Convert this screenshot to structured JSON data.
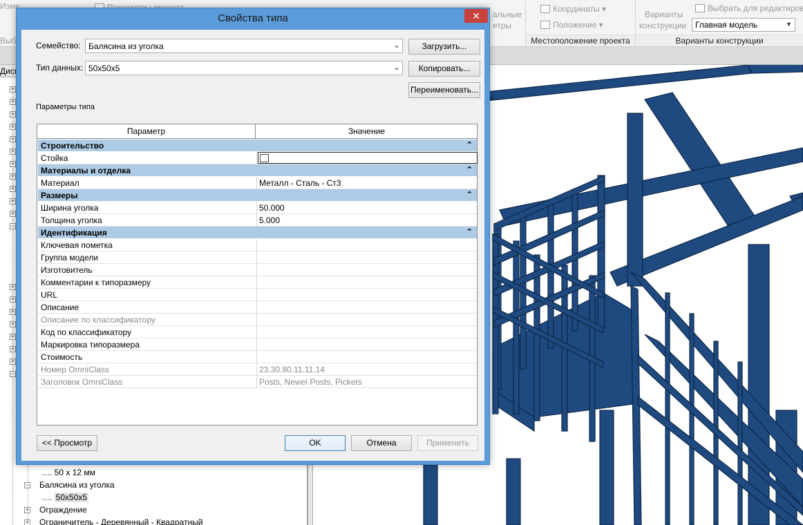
{
  "ribbon": {
    "left_partial": "Изме",
    "params_partial": "Параметры проекта",
    "left2_partial": "Выб",
    "walls_partial": "альные",
    "walls2_partial": "етры",
    "coordinates": "Координаты",
    "position": "Положение",
    "location_panel": "Местоположение проекта",
    "variants_btn_line1": "Варианты",
    "variants_btn_line2": "конструкции",
    "pick_for_edit": "Выбрать для редактирова",
    "main_model": "Главная модель",
    "variants_panel": "Варианты конструкции"
  },
  "browser": {
    "header": "Диспе",
    "items": [
      {
        "label": "50 x 12 мм",
        "indent": 2
      },
      {
        "label": "Балясина из уголка",
        "indent": 1
      },
      {
        "label": "50x50x5",
        "indent": 2
      },
      {
        "label": "Ограждение",
        "indent": 1
      },
      {
        "label": "Ограничитель - Деревянный - Квадратный",
        "indent": 1
      }
    ]
  },
  "dialog": {
    "title": "Свойства типа",
    "family_label": "Семейство:",
    "family_value": "Балясина из уголка",
    "type_label": "Тип данных:",
    "type_value": "50x50x5",
    "load_btn": "Загрузить...",
    "copy_btn": "Копировать...",
    "rename_btn": "Переименовать...",
    "params_label": "Параметры типа",
    "col_param": "Параметр",
    "col_value": "Значение",
    "preview_btn": "<< Просмотр",
    "ok_btn": "OK",
    "cancel_btn": "Отмена",
    "apply_btn": "Применить"
  },
  "groups": [
    {
      "name": "Строительство",
      "rows": [
        {
          "k": "Стойка",
          "v": "",
          "checkbox": true
        }
      ]
    },
    {
      "name": "Материалы и отделка",
      "rows": [
        {
          "k": "Материал",
          "v": "Металл - Сталь - Ст3"
        }
      ]
    },
    {
      "name": "Размеры",
      "rows": [
        {
          "k": "Ширина уголка",
          "v": "50.000"
        },
        {
          "k": "Толщина уголка",
          "v": "5.000"
        }
      ]
    },
    {
      "name": "Идентификация",
      "rows": [
        {
          "k": "Ключевая пометка",
          "v": ""
        },
        {
          "k": "Группа модели",
          "v": ""
        },
        {
          "k": "Изготовитель",
          "v": ""
        },
        {
          "k": "Комментарии к типоразмеру",
          "v": ""
        },
        {
          "k": "URL",
          "v": ""
        },
        {
          "k": "Описание",
          "v": ""
        },
        {
          "k": "Описание по классификатору",
          "v": "",
          "readonly": true
        },
        {
          "k": "Код по классификатору",
          "v": ""
        },
        {
          "k": "Маркировка типоразмера",
          "v": ""
        },
        {
          "k": "Стоимость",
          "v": ""
        },
        {
          "k": "Номер OmniClass",
          "v": "23.30.80.11.11.14",
          "readonly": true
        },
        {
          "k": "Заголовок OmniClass",
          "v": "Posts, Newel Posts, Pickets",
          "readonly": true
        }
      ]
    }
  ],
  "colors": {
    "steel": "#1e4a80",
    "dialog_frame": "#5b9bd9",
    "group_header": "#aecbe6",
    "close": "#c7423a"
  }
}
